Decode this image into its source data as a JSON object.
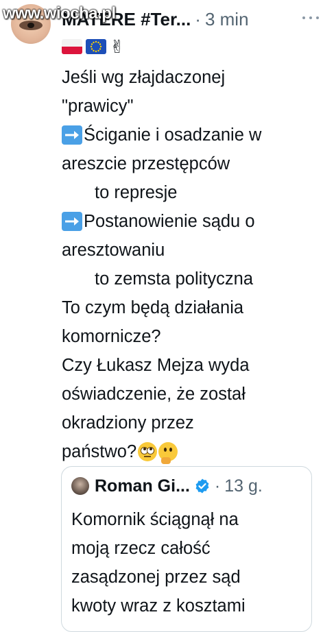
{
  "watermark": "www.wiocha.pl",
  "tweet": {
    "author_name": "MATERE #Ter...",
    "separator": "·",
    "time": "3 min",
    "lines": [
      "Jeśli wg złajdaczonej",
      "\"prawicy\"",
      "Ściganie i osadzanie w",
      "areszcie przestępców",
      "to represje",
      "Postanowienie sądu o",
      "aresztowaniu",
      "to zemsta polityczna",
      "To czym będą działania",
      "komornicze?",
      "Czy Łukasz Mejza wyda",
      "oświadczenie, że został",
      "okradziony przez",
      "państwo?"
    ]
  },
  "icons": {
    "more": "more-horizontal-icon",
    "flag_pl": "poland-flag-icon",
    "flag_eu": "eu-flag-icon",
    "victory": "victory-hand-icon",
    "arrow": "right-arrow-icon",
    "roll": "face-rolling-eyes-icon",
    "think": "thinking-face-icon",
    "verified": "verified-badge-icon"
  },
  "colors": {
    "text": "#0f1419",
    "secondary": "#536471",
    "verified": "#1d9bf0",
    "border": "#cfd9de"
  },
  "quote": {
    "author_name": "Roman Gi...",
    "separator": "·",
    "time": "13 g.",
    "lines": [
      "Komornik ściągnął na",
      "moją rzecz całość",
      "zasądzonej przez sąd",
      "kwoty wraz z kosztami"
    ]
  }
}
